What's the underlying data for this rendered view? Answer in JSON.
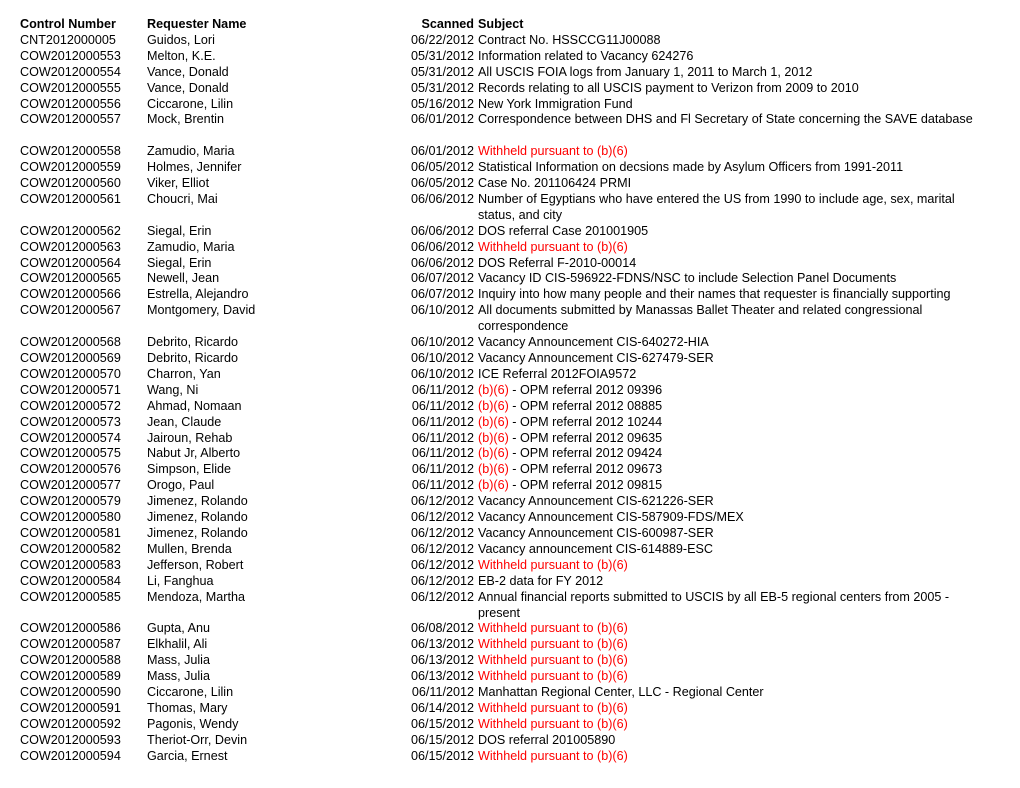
{
  "header": {
    "control": "Control Number",
    "name": "Requester Name",
    "scanned": "Scanned",
    "subject": "Subject"
  },
  "colors": {
    "redaction": "#ff0000",
    "text": "#000000"
  },
  "rows": [
    {
      "control": "CNT2012000005",
      "name": "Guidos, Lori",
      "scanned": "06/22/2012",
      "redacted": "",
      "subject": "Contract No. HSSCCG11J00088"
    },
    {
      "control": "COW2012000553",
      "name": "Melton, K.E.",
      "scanned": "05/31/2012",
      "redacted": "",
      "subject": "Information related to Vacancy 624276"
    },
    {
      "control": "COW2012000554",
      "name": "Vance, Donald",
      "scanned": "05/31/2012",
      "redacted": "",
      "subject": "All USCIS FOIA logs from January 1, 2011 to March 1, 2012"
    },
    {
      "control": "COW2012000555",
      "name": "Vance, Donald",
      "scanned": "05/31/2012",
      "redacted": "",
      "subject": "Records relating to all USCIS payment to Verizon from 2009 to 2010"
    },
    {
      "control": "COW2012000556",
      "name": "Ciccarone, Lilin",
      "scanned": "05/16/2012",
      "redacted": "",
      "subject": "New York Immigration Fund"
    },
    {
      "control": "COW2012000557",
      "name": "Mock, Brentin",
      "scanned": "06/01/2012",
      "redacted": "",
      "subject": "Correspondence between DHS and Fl Secretary of State concerning the SAVE database"
    },
    {
      "control": "",
      "name": "",
      "scanned": "",
      "redacted": "",
      "subject": ""
    },
    {
      "control": "COW2012000558",
      "name": "Zamudio, Maria",
      "scanned": "06/01/2012",
      "redacted": "Withheld pursuant to (b)(6)",
      "subject": ""
    },
    {
      "control": "COW2012000559",
      "name": "Holmes, Jennifer",
      "scanned": "06/05/2012",
      "redacted": "",
      "subject": "Statistical Information on decsions made by Asylum Officers from 1991-2011"
    },
    {
      "control": "COW2012000560",
      "name": "Viker, Elliot",
      "scanned": "06/05/2012",
      "redacted": "",
      "subject": "Case No. 201106424 PRMI"
    },
    {
      "control": "COW2012000561",
      "name": "Choucri, Mai",
      "scanned": "06/06/2012",
      "redacted": "",
      "subject": "Number of Egyptians who have entered the US from 1990 to include age, sex, marital\nstatus, and city"
    },
    {
      "control": "COW2012000562",
      "name": "Siegal, Erin",
      "scanned": "06/06/2012",
      "redacted": "",
      "subject": "DOS referral Case 201001905"
    },
    {
      "control": "COW2012000563",
      "name": "Zamudio, Maria",
      "scanned": "06/06/2012",
      "redacted": "Withheld pursuant to (b)(6)",
      "subject": ""
    },
    {
      "control": "COW2012000564",
      "name": "Siegal, Erin",
      "scanned": "06/06/2012",
      "redacted": "",
      "subject": "DOS Referral F-2010-00014"
    },
    {
      "control": "COW2012000565",
      "name": "Newell, Jean",
      "scanned": "06/07/2012",
      "redacted": "",
      "subject": "Vacancy ID CIS-596922-FDNS/NSC to include Selection Panel Documents"
    },
    {
      "control": "COW2012000566",
      "name": "Estrella, Alejandro",
      "scanned": "06/07/2012",
      "redacted": "",
      "subject": "Inquiry into how many people and their names that requester is financially supporting"
    },
    {
      "control": "COW2012000567",
      "name": "Montgomery, David",
      "scanned": "06/10/2012",
      "redacted": "",
      "subject": "All documents submitted by Manassas Ballet Theater and related congressional\ncorrespondence"
    },
    {
      "control": "COW2012000568",
      "name": "Debrito, Ricardo",
      "scanned": "06/10/2012",
      "redacted": "",
      "subject": "Vacancy Announcement CIS-640272-HIA"
    },
    {
      "control": "COW2012000569",
      "name": "Debrito, Ricardo",
      "scanned": "06/10/2012",
      "redacted": "",
      "subject": "Vacancy Announcement CIS-627479-SER"
    },
    {
      "control": "COW2012000570",
      "name": "Charron, Yan",
      "scanned": "06/10/2012",
      "redacted": "",
      "subject": "ICE Referral 2012FOIA9572"
    },
    {
      "control": "COW2012000571",
      "name": "Wang, Ni",
      "scanned": "06/11/2012",
      "redacted": "(b)(6)",
      "subject": " - OPM referral 2012 09396"
    },
    {
      "control": "COW2012000572",
      "name": "Ahmad, Nomaan",
      "scanned": "06/11/2012",
      "redacted": "(b)(6)",
      "subject": " - OPM referral 2012 08885"
    },
    {
      "control": "COW2012000573",
      "name": "Jean, Claude",
      "scanned": "06/11/2012",
      "redacted": "(b)(6)",
      "subject": " - OPM referral 2012 10244"
    },
    {
      "control": "COW2012000574",
      "name": "Jairoun, Rehab",
      "scanned": "06/11/2012",
      "redacted": "(b)(6)",
      "subject": " - OPM referral 2012 09635"
    },
    {
      "control": "COW2012000575",
      "name": "Nabut Jr, Alberto",
      "scanned": "06/11/2012",
      "redacted": "(b)(6)",
      "subject": " - OPM referral 2012 09424"
    },
    {
      "control": "COW2012000576",
      "name": "Simpson, Elide",
      "scanned": "06/11/2012",
      "redacted": "(b)(6)",
      "subject": " - OPM referral 2012 09673"
    },
    {
      "control": "COW2012000577",
      "name": "Orogo, Paul",
      "scanned": "06/11/2012",
      "redacted": "(b)(6)",
      "subject": " - OPM referral 2012 09815"
    },
    {
      "control": "COW2012000579",
      "name": "Jimenez, Rolando",
      "scanned": "06/12/2012",
      "redacted": "",
      "subject": "Vacancy Announcement CIS-621226-SER"
    },
    {
      "control": "COW2012000580",
      "name": "Jimenez, Rolando",
      "scanned": "06/12/2012",
      "redacted": "",
      "subject": "Vacancy Announcement CIS-587909-FDS/MEX"
    },
    {
      "control": "COW2012000581",
      "name": "Jimenez, Rolando",
      "scanned": "06/12/2012",
      "redacted": "",
      "subject": "Vacancy Announcement CIS-600987-SER"
    },
    {
      "control": "COW2012000582",
      "name": "Mullen, Brenda",
      "scanned": "06/12/2012",
      "redacted": "",
      "subject": "Vacancy announcement CIS-614889-ESC"
    },
    {
      "control": "COW2012000583",
      "name": "Jefferson, Robert",
      "scanned": "06/12/2012",
      "redacted": "Withheld pursuant to (b)(6)",
      "subject": ""
    },
    {
      "control": "COW2012000584",
      "name": "Li, Fanghua",
      "scanned": "06/12/2012",
      "redacted": "",
      "subject": "EB-2 data for FY 2012"
    },
    {
      "control": "COW2012000585",
      "name": "Mendoza, Martha",
      "scanned": "06/12/2012",
      "redacted": "",
      "subject": "Annual financial reports submitted to USCIS by all EB-5 regional centers from 2005 -\npresent"
    },
    {
      "control": "COW2012000586",
      "name": "Gupta, Anu",
      "scanned": "06/08/2012",
      "redacted": "Withheld pursuant to (b)(6)",
      "subject": ""
    },
    {
      "control": "COW2012000587",
      "name": "Elkhalil, Ali",
      "scanned": "06/13/2012",
      "redacted": "Withheld pursuant to (b)(6)",
      "subject": ""
    },
    {
      "control": "COW2012000588",
      "name": "Mass, Julia",
      "scanned": "06/13/2012",
      "redacted": "Withheld pursuant to (b)(6)",
      "subject": ""
    },
    {
      "control": "COW2012000589",
      "name": "Mass, Julia",
      "scanned": "06/13/2012",
      "redacted": "Withheld pursuant to (b)(6)",
      "subject": ""
    },
    {
      "control": "COW2012000590",
      "name": "Ciccarone, Lilin",
      "scanned": "06/11/2012",
      "redacted": "",
      "subject": "Manhattan Regional Center, LLC - Regional Center"
    },
    {
      "control": "COW2012000591",
      "name": "Thomas, Mary",
      "scanned": "06/14/2012",
      "redacted": "Withheld pursuant to (b)(6)",
      "subject": ""
    },
    {
      "control": "COW2012000592",
      "name": "Pagonis, Wendy",
      "scanned": "06/15/2012",
      "redacted": "Withheld pursuant to (b)(6)",
      "subject": ""
    },
    {
      "control": "COW2012000593",
      "name": "Theriot-Orr, Devin",
      "scanned": "06/15/2012",
      "redacted": "",
      "subject": "DOS referral 201005890"
    },
    {
      "control": "COW2012000594",
      "name": "Garcia, Ernest",
      "scanned": "06/15/2012",
      "redacted": "Withheld pursuant to (b)(6)",
      "subject": ""
    }
  ]
}
